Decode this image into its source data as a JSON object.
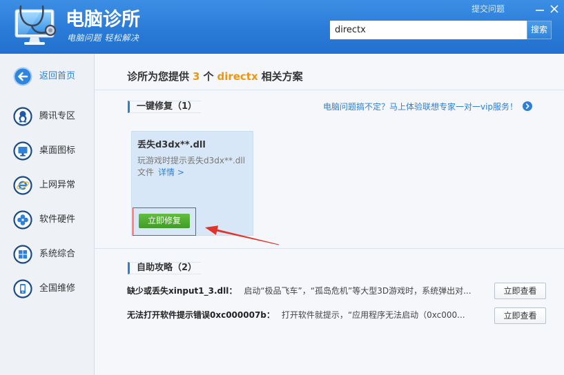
{
  "header": {
    "title": "电脑诊所",
    "subtitle": "电脑问题 轻松解决",
    "submit_label": "提交问题",
    "logo_icon": "monitor-stethoscope-icon",
    "search": {
      "value": "directx",
      "button_label": "搜索"
    }
  },
  "sidebar": {
    "items": [
      {
        "label": "返回首页",
        "icon": "back-arrow-icon",
        "active": true
      },
      {
        "label": "腾讯专区",
        "icon": "qq-penguin-icon"
      },
      {
        "label": "桌面图标",
        "icon": "monitor-icon"
      },
      {
        "label": "上网异常",
        "icon": "ie-browser-icon"
      },
      {
        "label": "软件硬件",
        "icon": "clover-icon"
      },
      {
        "label": "系统综合",
        "icon": "windows-icon"
      },
      {
        "label": "全国维修",
        "icon": "phone-icon"
      }
    ]
  },
  "main": {
    "heading": {
      "prefix": "诊所为您提供",
      "count": "3",
      "unit": "个",
      "keyword": "directx",
      "suffix": "相关方案"
    },
    "one_click": {
      "title": "一键修复（1）",
      "vip_link": "电脑问题搞不定？马上体验联想专家一对一vip服务！",
      "cards": [
        {
          "title": "丢失d3dx**.dll",
          "desc_line1": "玩游戏时提示丢失d3dx**.dll",
          "desc_line2": "文件",
          "detail_link": "详情 >",
          "fix_button": "立即修复"
        }
      ]
    },
    "self_help": {
      "title": "自助攻略（2）",
      "rows": [
        {
          "title": "缺少或丢失xinput1_3.dll：",
          "desc": "启动“极品飞车”，“孤岛危机”等大型3D游戏时，系统弹出对...",
          "button": "立即查看"
        },
        {
          "title": "无法打开软件提示错误0xc000007b：",
          "desc": "打开软件就提示，“应用程序无法启动（0xc000...",
          "button": "立即查看"
        }
      ]
    }
  },
  "colors": {
    "header_blue": "#2a7bd8",
    "accent_blue": "#2d7fd6",
    "highlight_orange": "#f0960e",
    "fix_green": "#4aa72e",
    "annotation_red": "#e0342a",
    "card_blue": "#d8e7f7"
  }
}
